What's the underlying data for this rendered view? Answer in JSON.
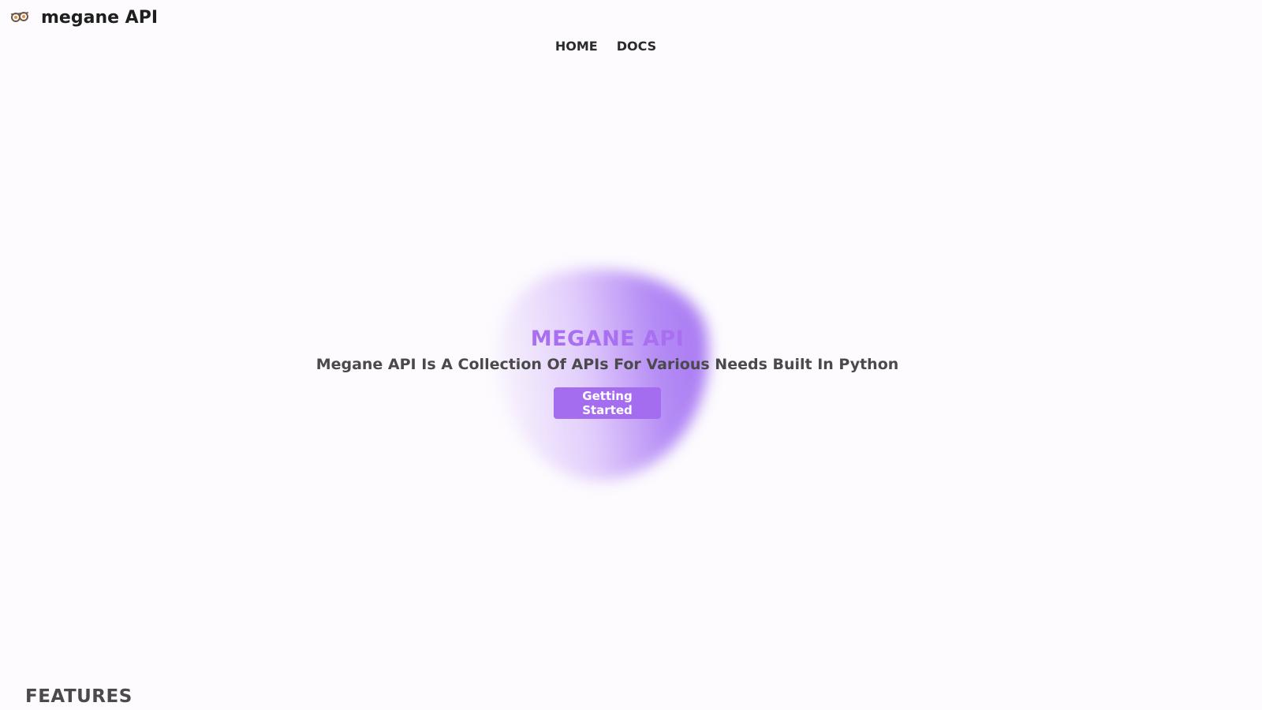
{
  "header": {
    "brand_name": "megane API",
    "logo_icon": "glasses-icon"
  },
  "nav": {
    "items": [
      {
        "label": "HOME"
      },
      {
        "label": "DOCS"
      }
    ]
  },
  "hero": {
    "title": "MEGANE API",
    "subtitle": "Megane API Is A Collection Of APIs For Various Needs Built In Python",
    "button_label": "Getting Started"
  },
  "features": {
    "heading": "FEATURES"
  },
  "colors": {
    "accent": "#a46df0",
    "title": "#a86ff0",
    "background": "#fdfbfe",
    "text_dark": "#1e1e1e",
    "text_muted": "#4a4a4a"
  }
}
